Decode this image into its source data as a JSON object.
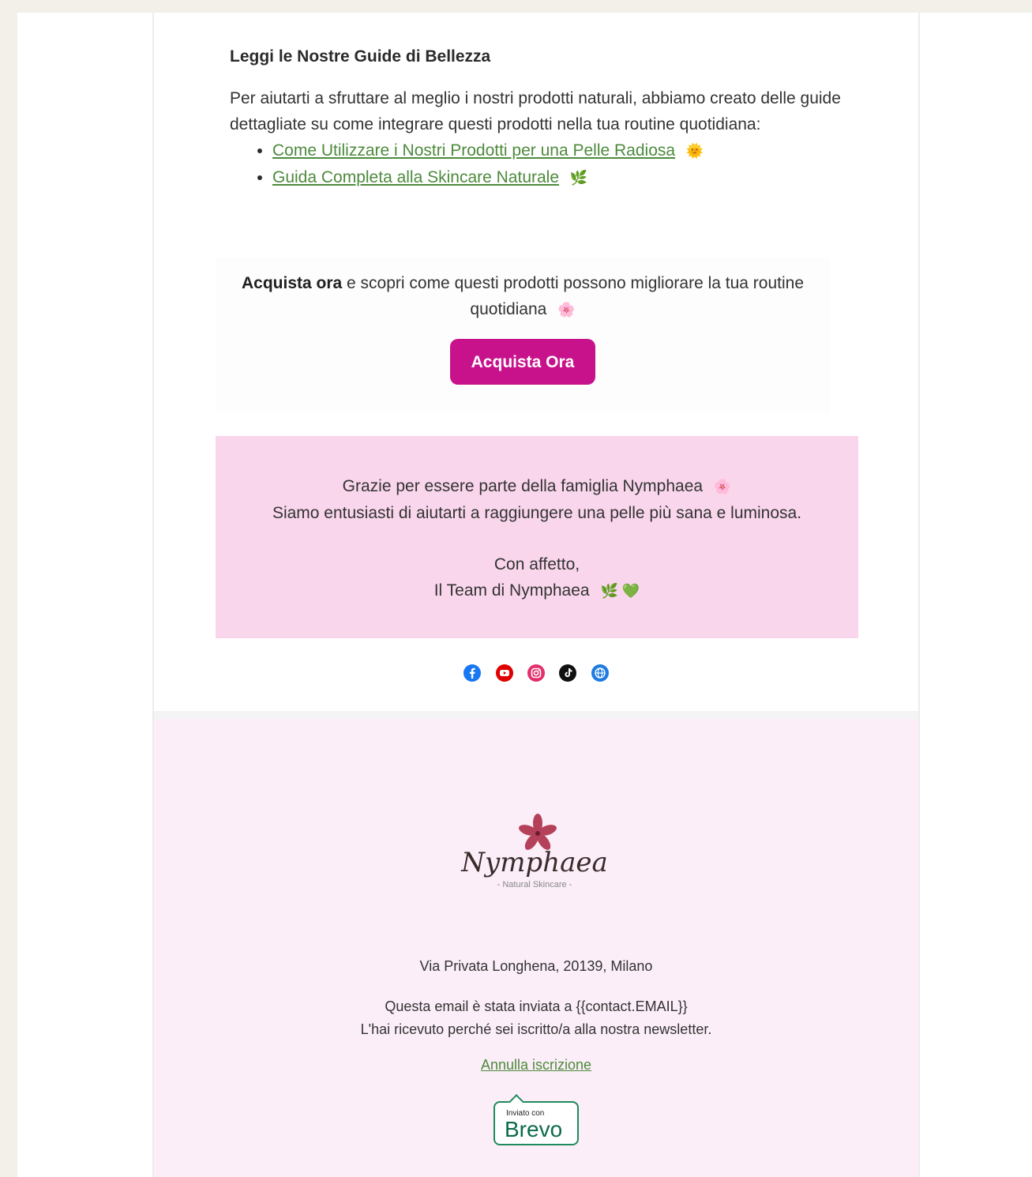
{
  "guides": {
    "title": "Leggi le Nostre Guide di Bellezza",
    "intro": "Per aiutarti a sfruttare al meglio i nostri prodotti naturali, abbiamo creato delle guide dettagliate su come integrare questi prodotti nella tua routine quotidiana:",
    "links": [
      {
        "label": "Come Utilizzare i Nostri Prodotti per una Pelle Radiosa",
        "emoji": "🌞"
      },
      {
        "label": "Guida Completa alla Skincare Naturale",
        "emoji": "🌿"
      }
    ]
  },
  "cta": {
    "bold": "Acquista ora",
    "text": " e scopri come questi prodotti possono migliorare la tua routine quotidiana",
    "emoji": "🌸",
    "button_label": "Acquista Ora",
    "button_color": "#c8128c"
  },
  "thanks": {
    "line1": "Grazie per essere parte della famiglia Nymphaea",
    "line1_emoji": "🌸",
    "line2": "Siamo entusiasti di aiutarti a raggiungere una pelle più sana e luminosa.",
    "signoff": "Con affetto,",
    "team": "Il Team di Nymphaea",
    "team_emoji": "🌿 💚",
    "bg_color": "#f9d6ec"
  },
  "social": {
    "icons": [
      "facebook-icon",
      "youtube-icon",
      "instagram-icon",
      "tiktok-icon",
      "website-icon"
    ]
  },
  "footer": {
    "logo_text": "Nymphaea",
    "logo_tagline": "- Natural Skincare -",
    "address": "Via Privata Longhena, 20139, Milano",
    "notice_line1": "Questa email è stata inviata a {{contact.EMAIL}}",
    "notice_line2": "L'hai ricevuto perché sei iscritto/a alla nostra newsletter.",
    "unsubscribe": "Annulla iscrizione",
    "badge_small": "Inviato con",
    "badge_big": "Brevo"
  }
}
